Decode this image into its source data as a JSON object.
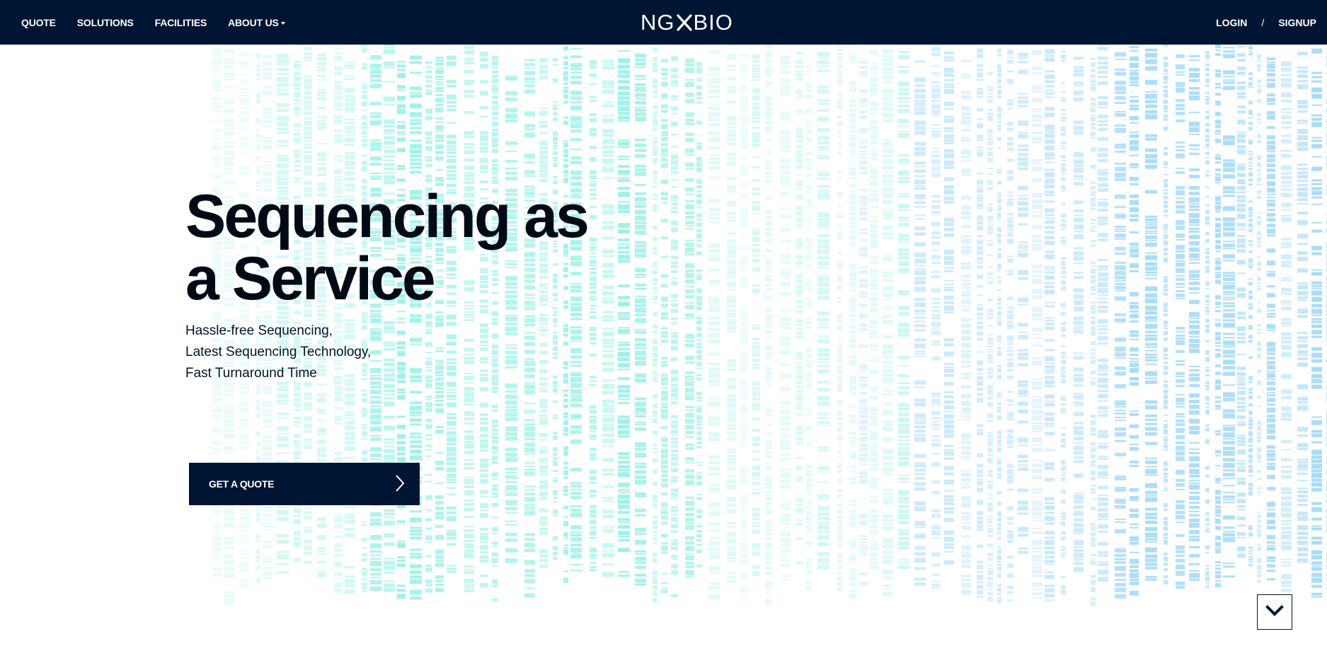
{
  "nav": {
    "links": [
      "QUOTE",
      "SOLUTIONS",
      "FACILITIES"
    ],
    "about_label": "ABOUT US",
    "logo_left": "NG",
    "logo_right": "BIO",
    "login_label": "LOGIN",
    "separator": "/",
    "signup_label": "SIGNUP"
  },
  "hero": {
    "title_line1": "Sequencing as",
    "title_line2": "a Service",
    "sub_line1": "Hassle-free Sequencing,",
    "sub_line2": "Latest Sequencing Technology,",
    "sub_line3": "Fast Turnaround Time",
    "cta_label": "GET A QUOTE"
  },
  "icons": {
    "logo_mark": "x-icon",
    "cta_arrow": "chevron-right-icon",
    "scroll": "chevron-down-icon",
    "dropdown": "caret-down-icon"
  },
  "colors": {
    "navbar": "#001533",
    "cta": "#001533",
    "text": "#000a14",
    "band_teal": "#5eead9",
    "band_blue": "#8fd3f7"
  }
}
